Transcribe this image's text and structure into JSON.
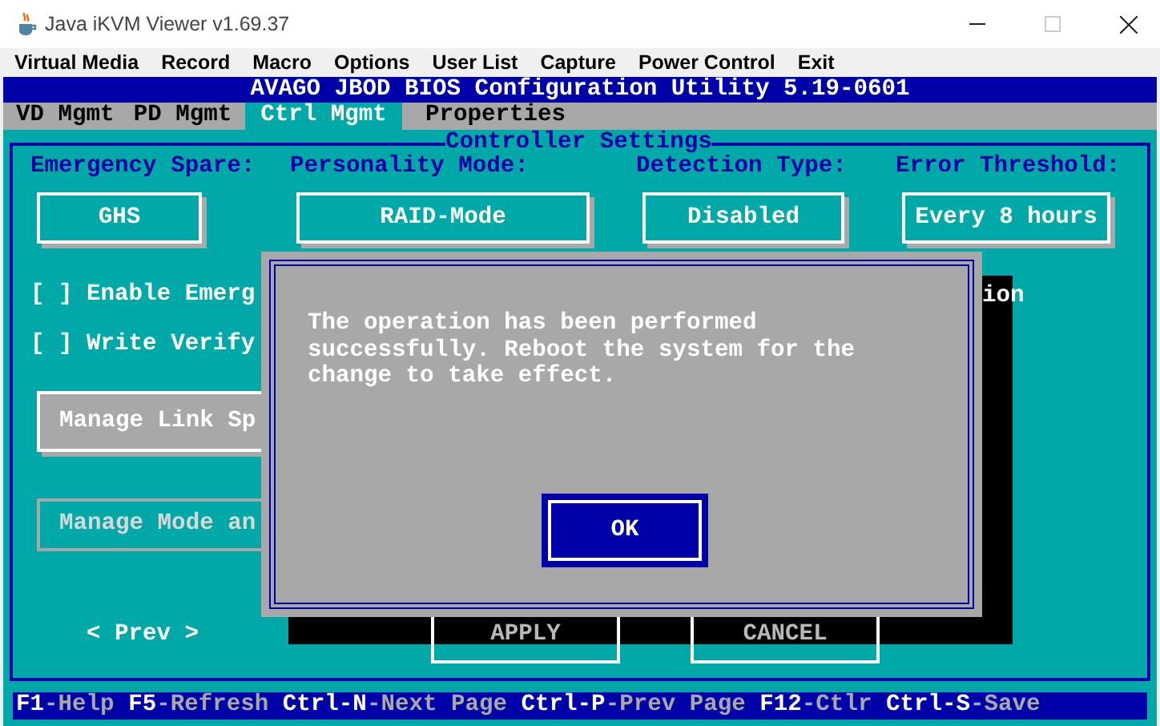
{
  "window": {
    "title": "Java iKVM Viewer v1.69.37"
  },
  "menu": [
    "Virtual Media",
    "Record",
    "Macro",
    "Options",
    "User List",
    "Capture",
    "Power Control",
    "Exit"
  ],
  "bios": {
    "title": "AVAGO JBOD BIOS Configuration Utility 5.19-0601",
    "tabs": [
      {
        "label": "VD Mgmt",
        "selected": false
      },
      {
        "label": "PD Mgmt",
        "selected": false
      },
      {
        "label": "Ctrl Mgmt",
        "selected": true
      },
      {
        "label": "Properties",
        "selected": false
      }
    ],
    "panel": {
      "title": "Controller Settings",
      "fields": [
        {
          "label": "Emergency Spare:",
          "value": "GHS"
        },
        {
          "label": "Personality Mode:",
          "value": "RAID-Mode"
        },
        {
          "label": "Detection Type:",
          "value": "Disabled"
        },
        {
          "label": "Error Threshold:",
          "value": "Every 8 hours"
        }
      ],
      "options": [
        "[ ] Enable Emerg",
        "[ ] Write Verify"
      ],
      "option_tail": "ion",
      "manage_buttons": [
        {
          "label": "Manage Link Sp",
          "disabled": false
        },
        {
          "label": "Manage Mode an",
          "disabled": true
        }
      ],
      "prev": "< Prev >",
      "actions": [
        "APPLY",
        "CANCEL"
      ]
    },
    "dialog": {
      "message": "The operation has been performed successfully. Reboot the system for the change to take effect.",
      "button": "OK"
    },
    "footer": [
      {
        "key": "F1",
        "label": "-Help"
      },
      {
        "key": "F5",
        "label": "-Refresh"
      },
      {
        "key": "Ctrl-N",
        "label": "-Next Page"
      },
      {
        "key": "Ctrl-P",
        "label": "-Prev Page"
      },
      {
        "key": "F12",
        "label": "-Ctlr"
      },
      {
        "key": "Ctrl-S",
        "label": "-Save"
      }
    ]
  }
}
